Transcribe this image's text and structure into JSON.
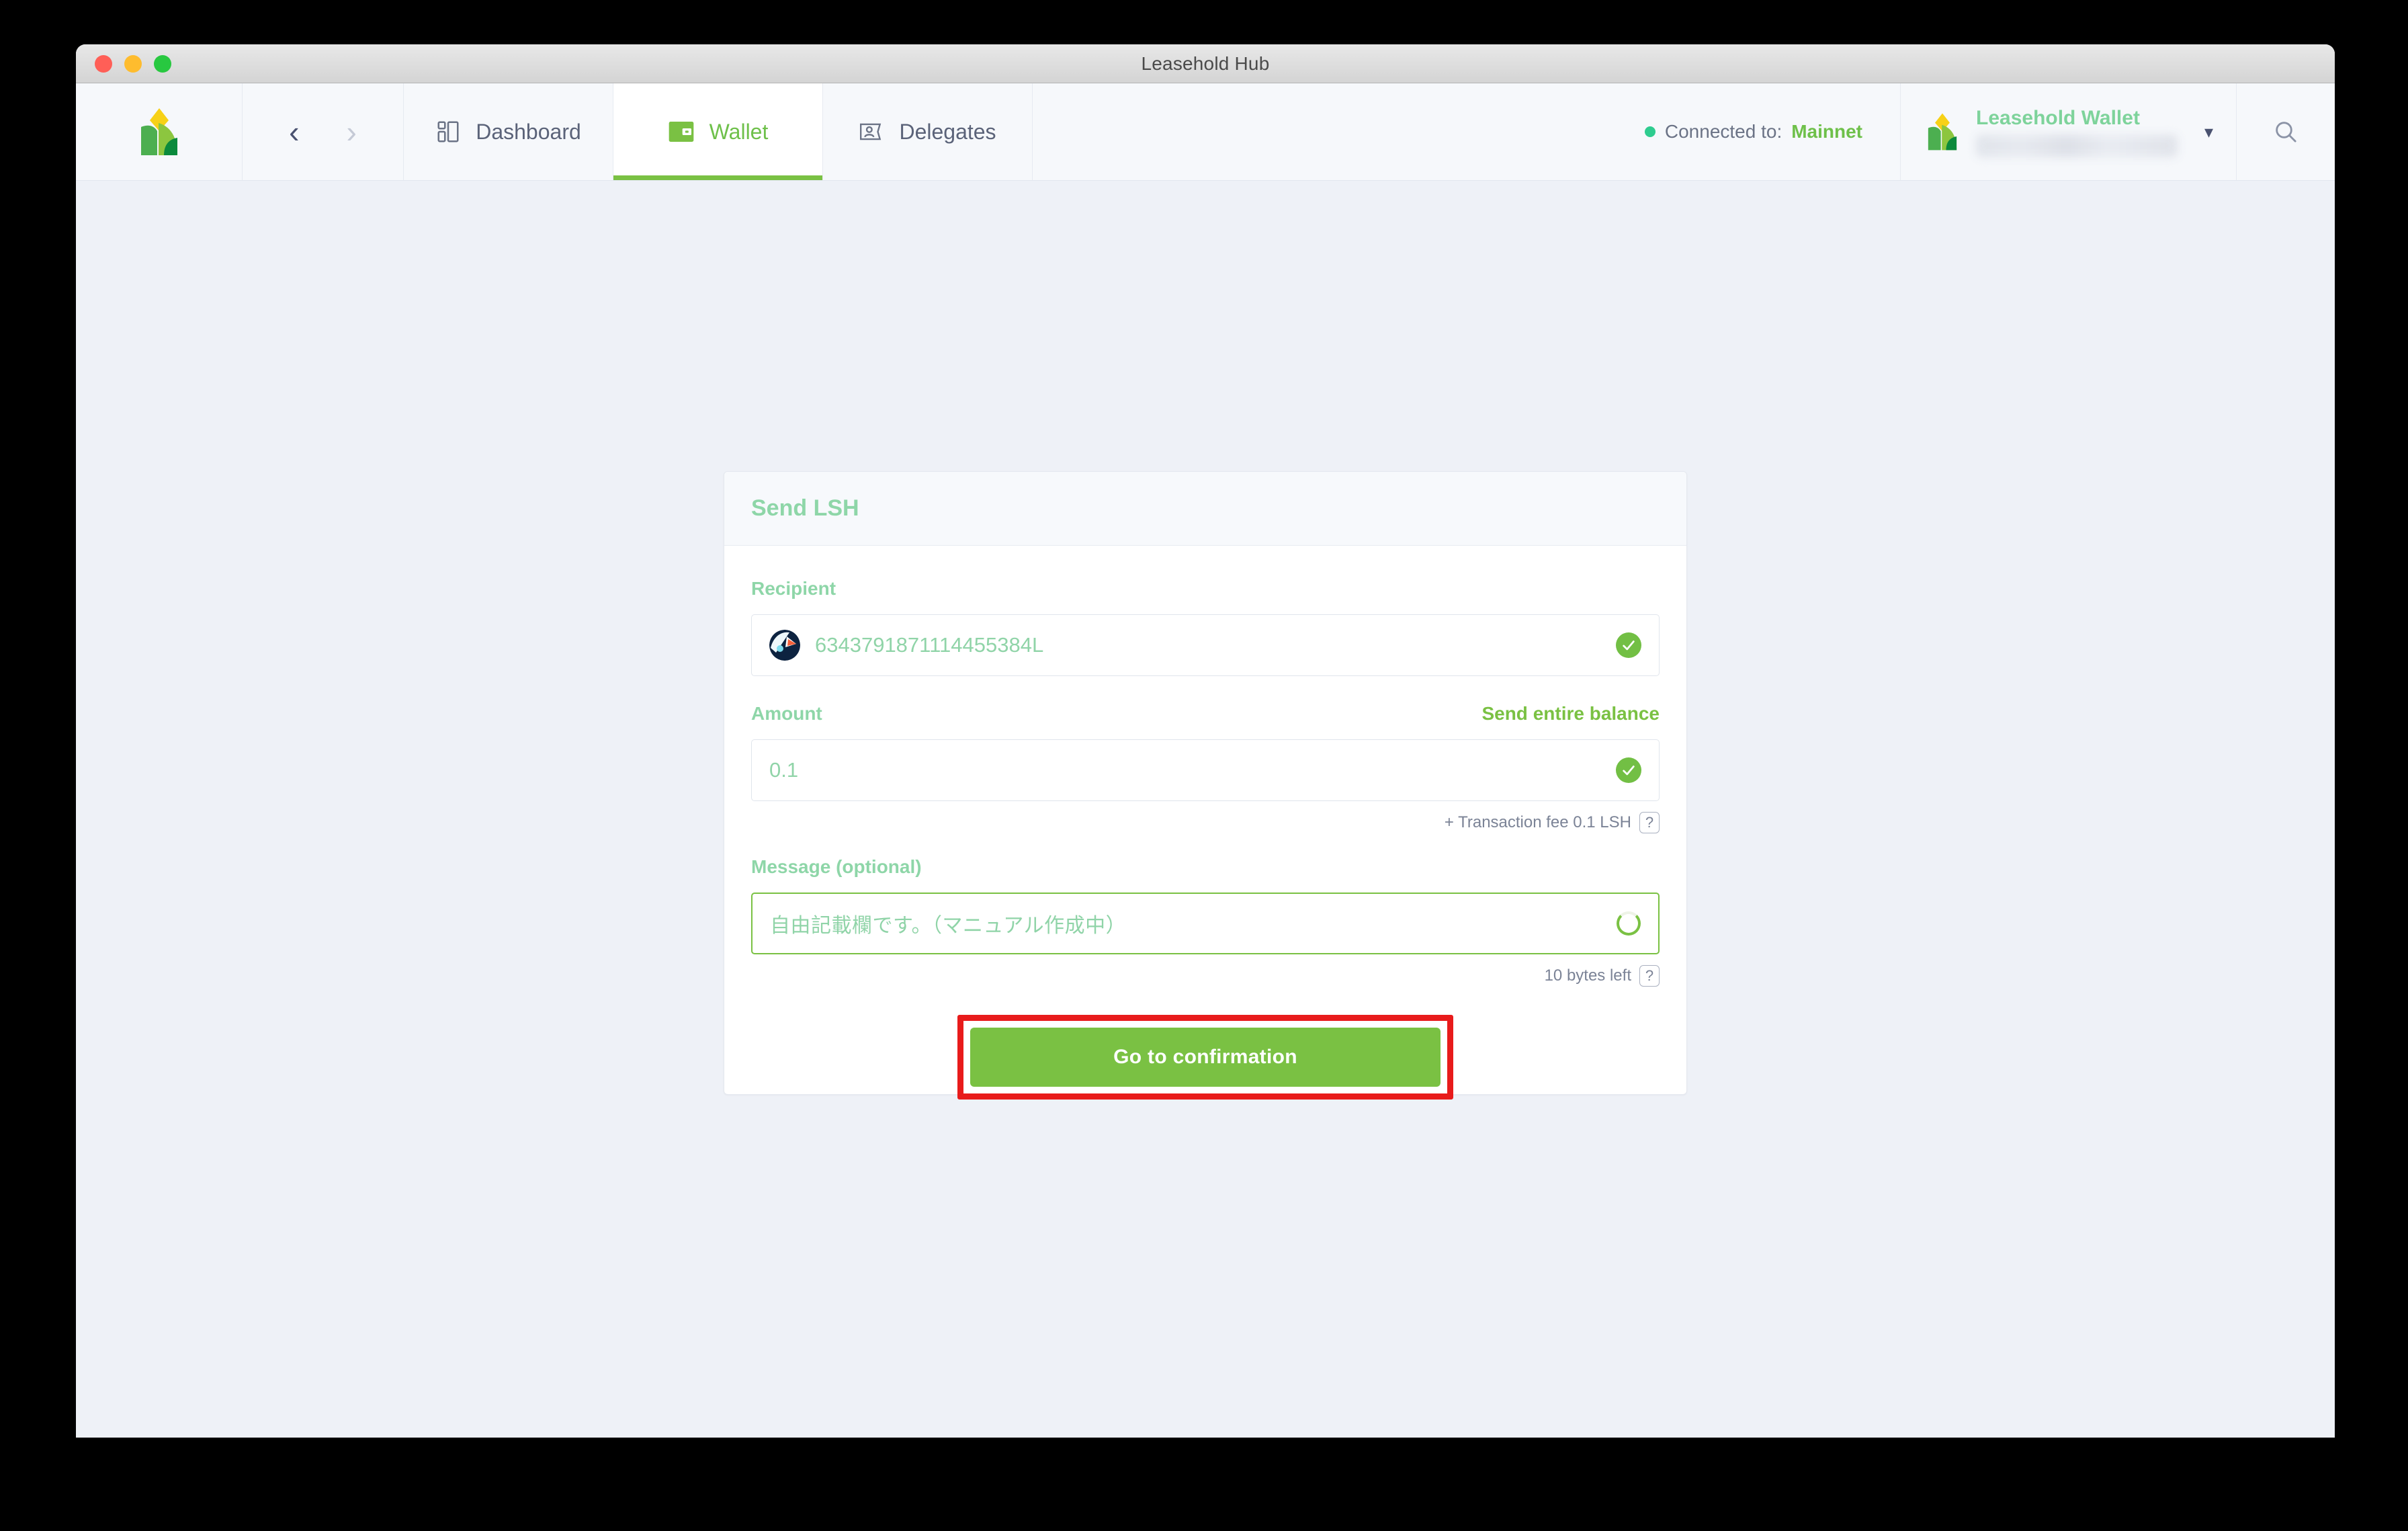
{
  "window": {
    "title": "Leasehold Hub",
    "traffic_lights": [
      "close-button",
      "minimize-button",
      "zoom-button"
    ]
  },
  "header": {
    "logo_icon": "leasehold-logo-icon",
    "nav": {
      "back_icon": "chevron-left-icon",
      "forward_icon": "chevron-right-icon"
    },
    "tabs": [
      {
        "label": "Dashboard",
        "icon": "dashboard-grid-icon",
        "active": false
      },
      {
        "label": "Wallet",
        "icon": "wallet-icon",
        "active": true
      },
      {
        "label": "Delegates",
        "icon": "delegates-card-icon",
        "active": false
      }
    ],
    "connection": {
      "prefix": "Connected to:",
      "network": "Mainnet",
      "status_dot_color": "#2ecc8f"
    },
    "wallet": {
      "name": "Leasehold Wallet",
      "address_redacted": true,
      "caret_icon": "chevron-down-icon"
    },
    "search_icon": "search-icon"
  },
  "send_form": {
    "card_title": "Send LSH",
    "recipient": {
      "label": "Recipient",
      "value": "6343791871114455384L",
      "avatar_icon": "identicon-avatar",
      "valid_icon": "check-circle-icon"
    },
    "amount": {
      "label": "Amount",
      "send_entire_balance": "Send entire balance",
      "value": "0.1",
      "valid_icon": "check-circle-icon",
      "fee_hint": "+ Transaction fee 0.1 LSH",
      "fee_help_icon": "?"
    },
    "message": {
      "label": "Message (optional)",
      "value": "自由記載欄です。（マニュアル作成中）",
      "spinner_icon": "loading-spinner-icon",
      "bytes_left": "10 bytes left",
      "bytes_help_icon": "?",
      "focused": true
    },
    "submit_label": "Go to confirmation"
  },
  "colors": {
    "accent_green": "#7ac143",
    "soft_green": "#8ed6a8",
    "annotation_red": "#e81b1b",
    "status_teal": "#2ecc8f",
    "page_bg": "#eef1f7"
  }
}
